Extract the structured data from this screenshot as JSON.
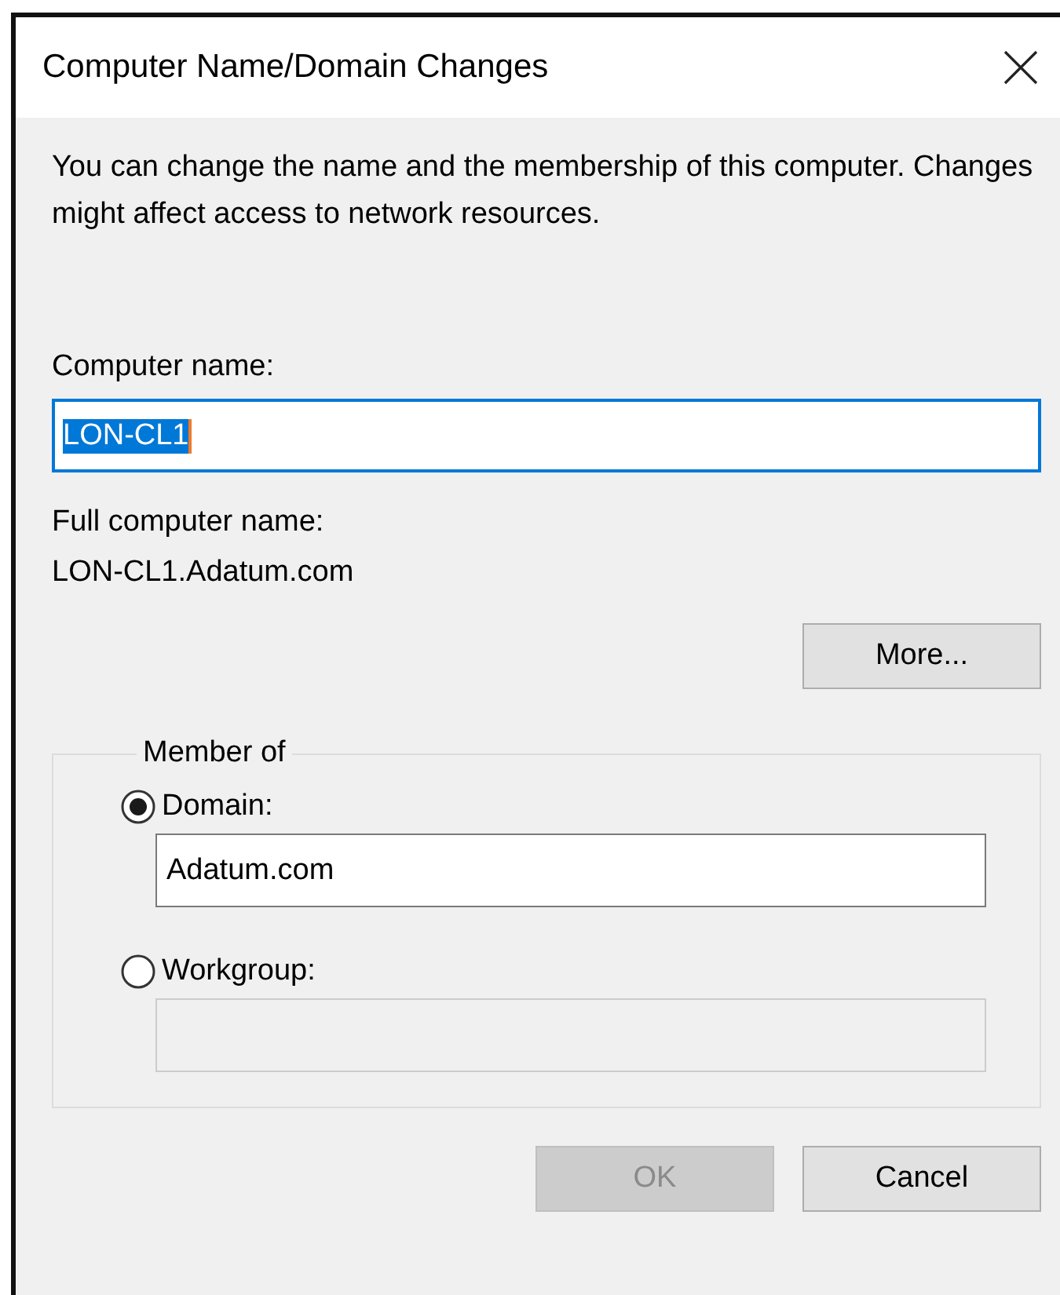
{
  "window": {
    "title": "Computer Name/Domain Changes"
  },
  "description": "You can change the name and the membership of this computer. Changes might affect access to network resources.",
  "computer_name": {
    "label": "Computer name:",
    "value": "LON-CL1",
    "selected": true,
    "focused": true
  },
  "full_computer_name": {
    "label": "Full computer name:",
    "value": "LON-CL1.Adatum.com"
  },
  "more_button": {
    "label": "More..."
  },
  "member_of": {
    "title": "Member of",
    "options": [
      {
        "label": "Domain:",
        "selected": true,
        "value": "Adatum.com",
        "disabled": false
      },
      {
        "label": "Workgroup:",
        "selected": false,
        "disabled": true
      }
    ]
  },
  "buttons": [
    {
      "label": "OK",
      "disabled": true
    },
    {
      "label": "Cancel",
      "disabled": false
    }
  ]
}
